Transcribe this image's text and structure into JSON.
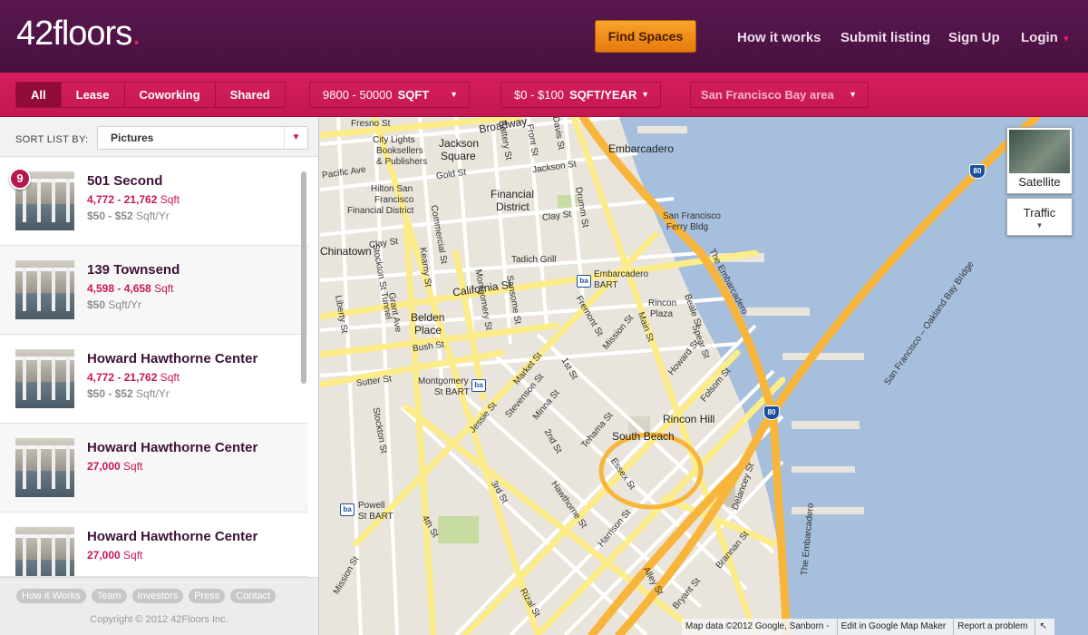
{
  "header": {
    "logo_main": "42floors",
    "logo_dot": ".",
    "find_spaces": "Find Spaces",
    "nav": [
      "How it works",
      "Submit listing",
      "Sign Up",
      "Login"
    ],
    "login_caret": "▼"
  },
  "filters": {
    "types": [
      "All",
      "Lease",
      "Coworking",
      "Shared"
    ],
    "active_type": "All",
    "sqft_range": "9800 - 50000",
    "sqft_unit": "SQFT",
    "price_range": "$0 - $100",
    "price_unit": "SQFT/YEAR",
    "location": "San Francisco Bay area",
    "caret": "▼"
  },
  "sort": {
    "label": "SORT LIST BY:",
    "value": "Pictures"
  },
  "listings": [
    {
      "badge": "9",
      "title": "501 Second",
      "sqft_range": "4,772 - 21,762",
      "sqft_unit": " Sqft",
      "price_range": "$50 - $52",
      "price_unit": " Sqft/Yr"
    },
    {
      "title": "139 Townsend",
      "sqft_range": "4,598 - 4,658",
      "sqft_unit": " Sqft",
      "price_range": "$50",
      "price_unit": " Sqft/Yr"
    },
    {
      "title": "Howard Hawthorne Center",
      "sqft_range": "4,772 - 21,762",
      "sqft_unit": " Sqft",
      "price_range": "$50 - $52",
      "price_unit": " Sqft/Yr"
    },
    {
      "title": "Howard Hawthorne Center",
      "sqft_range": "27,000",
      "sqft_unit": " Sqft"
    },
    {
      "title": "Howard Hawthorne Center",
      "sqft_range": "27,000",
      "sqft_unit": " Sqft"
    }
  ],
  "footer": {
    "links": [
      "How it Works",
      "Team",
      "Investors",
      "Press",
      "Contact"
    ],
    "copyright": "Copyright © 2012 42Floors Inc."
  },
  "map": {
    "satellite": "Satellite",
    "traffic": "Traffic",
    "traffic_caret": "▼",
    "bart_icon": "bart-icon",
    "bart_text": "ba",
    "highway": "80",
    "labels": {
      "fresno": "Fresno St",
      "broadway": "Broadway",
      "city_lights": "City Lights",
      "booksellers": "Booksellers",
      "publishers": "& Publishers",
      "jackson": "Jackson",
      "square": "Square",
      "jackson_st": "Jackson St",
      "pacific": "Pacific Ave",
      "embarcadero": "Embarcadero",
      "gold": "Gold St",
      "hilton": "Hilton San",
      "francisco": "Francisco",
      "financial_district_hotel": "Financial District",
      "financial": "Financial",
      "district": "District",
      "clay": "Clay St",
      "sf_ferry": "San Francisco",
      "ferry_bldg": "Ferry Bldg",
      "chinatown": "Chinatown",
      "clay_st2": "Clay St",
      "tadich": "Tadich Grill",
      "embarcadero_bart": "Embarcadero",
      "bart": "BART",
      "california": "California St",
      "kearny": "Kearny St",
      "rincon_plaza": "Rincon",
      "plaza": "Plaza",
      "belden": "Belden",
      "place": "Place",
      "bush": "Bush St",
      "montgomery_bart": "Montgomery",
      "st_bart": "St BART",
      "sutter": "Sutter St",
      "rincon_hill": "Rincon Hill",
      "south_beach": "South Beach",
      "powell": "Powell",
      "powell_st_bart": "St BART",
      "bay_bridge": "San Francisco – Oakland Bay Bridge",
      "the_embarcadero": "The Embarcadero",
      "the_embarcadero2": "The Embarcadero",
      "mission": "Mission St",
      "market": "Market St",
      "folsom": "Folsom St",
      "howard": "Howard St",
      "main": "Main St",
      "beale": "Beale St",
      "fremont": "Fremont St",
      "first": "1st St",
      "second": "2nd St",
      "third": "3rd St",
      "fourth": "4th St",
      "montgomery_st": "Montgomery St",
      "harrison": "Harrison St",
      "brannan": "Brannan St",
      "stockton": "Stockton St",
      "grant": "Grant Ave",
      "battery": "Battery St",
      "sansome": "Sansome St",
      "front": "Front St",
      "davis": "Davis St",
      "drumm": "Drumm St",
      "spear": "Spear St",
      "hawthorne": "Hawthorne St",
      "essex": "Essex St",
      "tehama": "Tehama St",
      "minna": "Minna St",
      "jessie": "Jessie St",
      "stevenson": "Stevenson St",
      "stockton_tunnel": "Stockton St Tunnel",
      "delancey": "Delancey St",
      "bryant": "Bryant St",
      "alley": "Alley St",
      "rizal": "Rizal St",
      "commercial": "Commercial St",
      "liberty": "Liberty St"
    },
    "attribution": "Map data ©2012 Google, Sanborn -",
    "edit_link": "Edit in Google Map Maker",
    "report_link": "Report a problem",
    "corner_icon": "↖"
  }
}
